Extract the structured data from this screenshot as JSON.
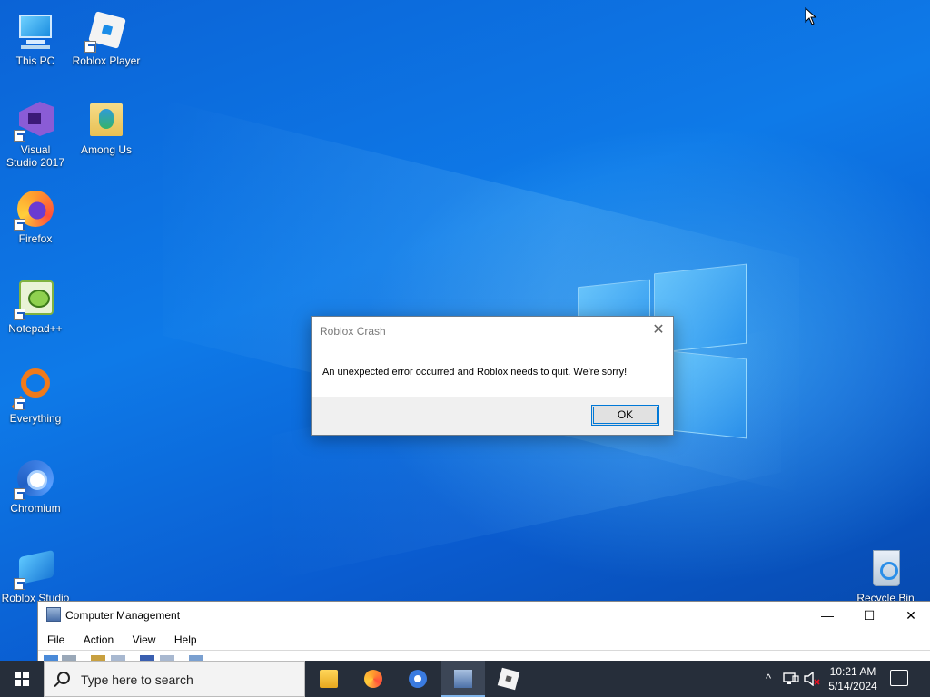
{
  "desktop": {
    "icons": [
      {
        "label": "This PC"
      },
      {
        "label": "Roblox Player"
      },
      {
        "label": "Visual Studio 2017"
      },
      {
        "label": "Among Us"
      },
      {
        "label": "Firefox"
      },
      {
        "label": "Notepad++"
      },
      {
        "label": "Everything"
      },
      {
        "label": "Chromium"
      },
      {
        "label": "Roblox Studio"
      },
      {
        "label": "Recycle Bin"
      }
    ]
  },
  "dialog": {
    "title": "Roblox Crash",
    "message": "An unexpected error occurred and Roblox needs to quit.  We're sorry!",
    "ok_label": "OK",
    "close_glyph": "✕"
  },
  "computer_management": {
    "title": "Computer Management",
    "menu": [
      "File",
      "Action",
      "View",
      "Help"
    ],
    "minimize_glyph": "—",
    "maximize_glyph": "☐",
    "close_glyph": "✕"
  },
  "taskbar": {
    "search_placeholder": "Type here to search",
    "clock_time": "10:21 AM",
    "clock_date": "5/14/2024",
    "tray_up_glyph": "^",
    "apps": [
      "file-explorer",
      "firefox",
      "chromium",
      "computer-management",
      "roblox-player"
    ],
    "active_app": "computer-management"
  },
  "colors": {
    "accent": "#0078d7",
    "taskbar": "#262e3a"
  }
}
